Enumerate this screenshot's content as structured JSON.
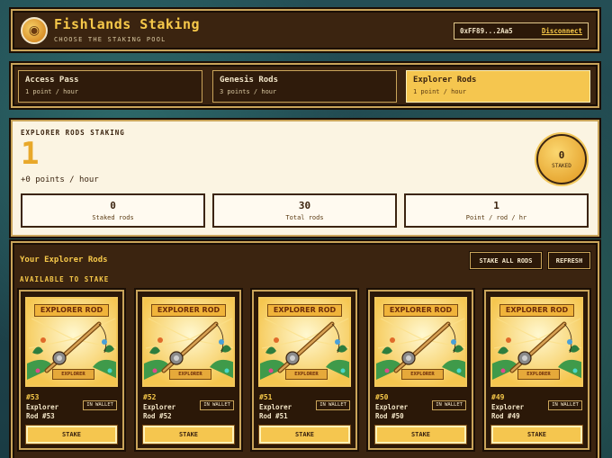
{
  "header": {
    "title": "Fishlands Staking",
    "subtitle": "CHOOSE THE STAKING POOL",
    "logo_icon": "fish-mascot-icon",
    "wallet_address": "0xFF89...2Aa5",
    "disconnect_label": "Disconnect"
  },
  "pools": [
    {
      "name": "Access Pass",
      "rate": "1 point / hour",
      "active": false
    },
    {
      "name": "Genesis Rods",
      "rate": "3 points / hour",
      "active": false
    },
    {
      "name": "Explorer Rods",
      "rate": "1 point / hour",
      "active": true
    }
  ],
  "summary": {
    "label": "EXPLORER RODS STAKING",
    "big_value": "1",
    "rate_text": "+0 points / hour",
    "staked_count": "0",
    "staked_label": "STAKED",
    "stats": [
      {
        "value": "0",
        "label": "Staked rods"
      },
      {
        "value": "30",
        "label": "Total rods"
      },
      {
        "value": "1",
        "label": "Point / rod / hr"
      }
    ]
  },
  "rods": {
    "title": "Your Explorer Rods",
    "available_label": "AVAILABLE TO STAKE",
    "stake_all_label": "STAKE ALL RODS",
    "refresh_label": "REFRESH",
    "card_banner": "EXPLORER ROD",
    "card_plaque": "EXPLORER",
    "items": [
      {
        "id": "#53",
        "name": "Explorer Rod #53",
        "badge": "IN WALLET",
        "action": "STAKE"
      },
      {
        "id": "#52",
        "name": "Explorer Rod #52",
        "badge": "IN WALLET",
        "action": "STAKE"
      },
      {
        "id": "#51",
        "name": "Explorer Rod #51",
        "badge": "IN WALLET",
        "action": "STAKE"
      },
      {
        "id": "#50",
        "name": "Explorer Rod #50",
        "badge": "IN WALLET",
        "action": "STAKE"
      },
      {
        "id": "#49",
        "name": "Explorer Rod #49",
        "badge": "IN WALLET",
        "action": "STAKE"
      }
    ]
  },
  "colors": {
    "accent_gold": "#f5c64f",
    "panel_brown": "#3b2410",
    "cream": "#fbf4e2"
  }
}
